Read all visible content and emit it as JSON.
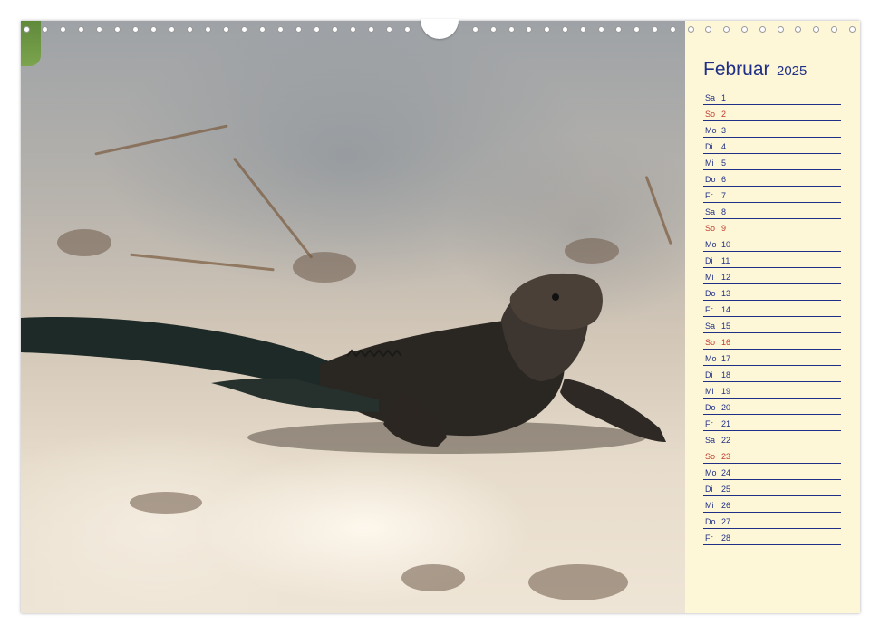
{
  "calendar": {
    "month": "Februar",
    "year": "2025",
    "days": [
      {
        "weekday": "Sa",
        "day": "1",
        "sunday": false
      },
      {
        "weekday": "So",
        "day": "2",
        "sunday": true
      },
      {
        "weekday": "Mo",
        "day": "3",
        "sunday": false
      },
      {
        "weekday": "Di",
        "day": "4",
        "sunday": false
      },
      {
        "weekday": "Mi",
        "day": "5",
        "sunday": false
      },
      {
        "weekday": "Do",
        "day": "6",
        "sunday": false
      },
      {
        "weekday": "Fr",
        "day": "7",
        "sunday": false
      },
      {
        "weekday": "Sa",
        "day": "8",
        "sunday": false
      },
      {
        "weekday": "So",
        "day": "9",
        "sunday": true
      },
      {
        "weekday": "Mo",
        "day": "10",
        "sunday": false
      },
      {
        "weekday": "Di",
        "day": "11",
        "sunday": false
      },
      {
        "weekday": "Mi",
        "day": "12",
        "sunday": false
      },
      {
        "weekday": "Do",
        "day": "13",
        "sunday": false
      },
      {
        "weekday": "Fr",
        "day": "14",
        "sunday": false
      },
      {
        "weekday": "Sa",
        "day": "15",
        "sunday": false
      },
      {
        "weekday": "So",
        "day": "16",
        "sunday": true
      },
      {
        "weekday": "Mo",
        "day": "17",
        "sunday": false
      },
      {
        "weekday": "Di",
        "day": "18",
        "sunday": false
      },
      {
        "weekday": "Mi",
        "day": "19",
        "sunday": false
      },
      {
        "weekday": "Do",
        "day": "20",
        "sunday": false
      },
      {
        "weekday": "Fr",
        "day": "21",
        "sunday": false
      },
      {
        "weekday": "Sa",
        "day": "22",
        "sunday": false
      },
      {
        "weekday": "So",
        "day": "23",
        "sunday": true
      },
      {
        "weekday": "Mo",
        "day": "24",
        "sunday": false
      },
      {
        "weekday": "Di",
        "day": "25",
        "sunday": false
      },
      {
        "weekday": "Mi",
        "day": "26",
        "sunday": false
      },
      {
        "weekday": "Do",
        "day": "27",
        "sunday": false
      },
      {
        "weekday": "Fr",
        "day": "28",
        "sunday": false
      }
    ]
  },
  "colors": {
    "text": "#1f2f86",
    "sunday": "#c0392b",
    "panel": "#fdf7d8"
  },
  "photo": {
    "subject_icon": "iguana-on-sand-photo"
  }
}
